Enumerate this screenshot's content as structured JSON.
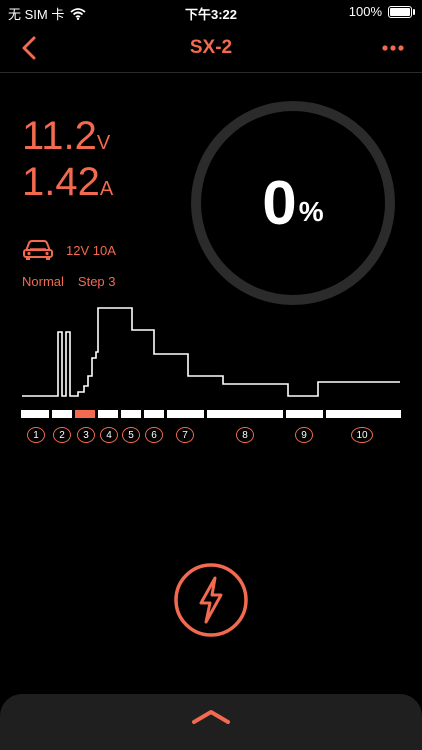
{
  "status": {
    "carrier": "无 SIM 卡",
    "time": "下午3:22",
    "battery": "100%"
  },
  "nav": {
    "title": "SX-2",
    "back_icon": "chevron-left-icon",
    "more_icon": "ellipsis-icon"
  },
  "readings": {
    "voltage": "11.2",
    "voltage_unit": "V",
    "current": "1.42",
    "current_unit": "A"
  },
  "vehicle": {
    "icon": "car-icon",
    "spec": "12V 10A"
  },
  "mode": {
    "name": "Normal",
    "step": "Step 3"
  },
  "progress": {
    "value": "0",
    "sign": "%"
  },
  "steps": {
    "labels": [
      "1",
      "2",
      "3",
      "4",
      "5",
      "6",
      "7",
      "8",
      "9",
      "10"
    ],
    "active": 3
  },
  "charge_button": {
    "icon": "lightning-bolt-icon"
  },
  "drawer": {
    "icon": "chevron-up-icon"
  },
  "colors": {
    "accent": "#f26a4f",
    "background": "#000000",
    "ring": "#2b2b2b"
  }
}
